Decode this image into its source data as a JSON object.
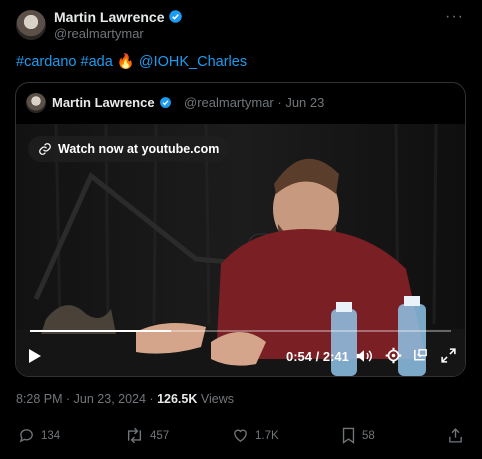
{
  "author": {
    "name": "Martin Lawrence",
    "handle": "@realmartymar"
  },
  "more_label": "···",
  "tweet": {
    "hashtag1": "#cardano",
    "hashtag2": "#ada",
    "emoji": "🔥",
    "mention": "@IOHK_Charles"
  },
  "quote": {
    "name": "Martin Lawrence",
    "handle_date": "@realmartymar · Jun 23",
    "watch_label": "Watch now at youtube.com",
    "time": "0:54 / 2:41",
    "progress": 0.335
  },
  "meta": {
    "datetime": "8:28 PM · Jun 23, 2024 · ",
    "views_count": "126.5K",
    "views_label": " Views"
  },
  "actions": {
    "replies": "134",
    "reposts": "457",
    "likes": "1.7K",
    "bookmarks": "58"
  },
  "colors": {
    "accent": "#1d9bf0",
    "muted": "#71767b",
    "text": "#e7e9ea",
    "background": "#000000"
  }
}
